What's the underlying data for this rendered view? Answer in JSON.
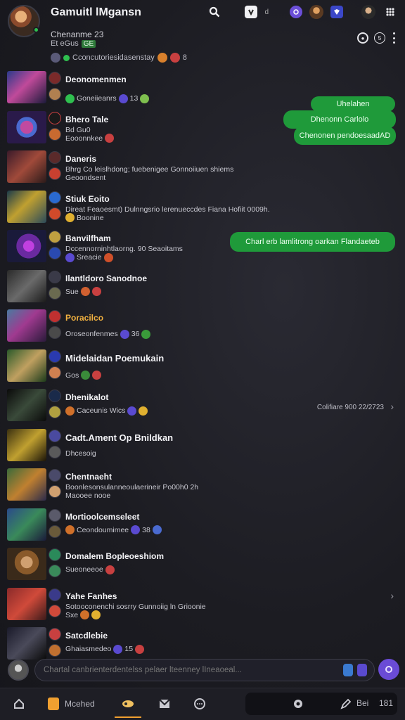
{
  "header": {
    "title": "Gamuitl lMgansn",
    "subtitle": "Chenanme 23",
    "subtitle2": "Et eGus",
    "subtitle2_tag": "GE",
    "status": "Cconcutoriesidasenstay",
    "status_count": "8"
  },
  "conversations": [
    {
      "name": "Deonomenmen",
      "msg": "",
      "meta": "Goneiieanrs",
      "meta_num": "13"
    },
    {
      "name": "Bhero Tale",
      "msg": "Bd Gu0",
      "meta": "Eooonnkee",
      "meta_num": ""
    },
    {
      "name": "Daneris",
      "msg": "Bhrg Co leislhdong; fuebenigee Gonnoiiuen shiems",
      "meta": "Geoondsent",
      "meta_num": ""
    },
    {
      "name": "Stiuk Eoito",
      "msg": "Direat Feaoesmt) Dulnngsrio lerenueccdes Fiana Hofiit 0009h.",
      "meta": "Boonine",
      "meta_num": ""
    },
    {
      "name": "Banvilfham",
      "msg": "Dccennorninhtlaorng. 90 Seaoitams",
      "meta": "Sreacie",
      "meta_num": ""
    },
    {
      "name": "Ilantldoro Sanodnoe",
      "msg": "",
      "meta": "Sue",
      "meta_num": ""
    },
    {
      "name": "Poracilco",
      "msg": "",
      "meta": "Oroseonfenmes",
      "meta_num": "36"
    },
    {
      "name": "Midelaidan Poemukain",
      "msg": "",
      "meta": "Gos",
      "meta_num": ""
    },
    {
      "name": "Dhenikalot",
      "msg": "",
      "meta": "Caceunis Wics",
      "meta_num": "",
      "right": "Colifiare 900 22/2723"
    },
    {
      "name": "Cadt.Ament Op Bnildkan",
      "msg": "",
      "meta": "Dhcesoig",
      "meta_num": ""
    },
    {
      "name": "Chentnaeht",
      "msg": "Boonlesonsulanneoulaerineir Po00h0 2h",
      "meta": "Maooee nooe",
      "meta_num": ""
    },
    {
      "name": "Mortioolcemseleet",
      "msg": "",
      "meta": "Ceondoumimee",
      "meta_num": "38"
    },
    {
      "name": "Domalem Bopleoeshiom",
      "msg": "",
      "meta": "Sueoneeoe",
      "meta_num": ""
    },
    {
      "name": "Yahe Fanhes",
      "msg": "Sotooconenchi sosrry Gunnoiig ln Grioonie",
      "meta": "Sxe",
      "meta_num": ""
    },
    {
      "name": "Satcdlebie",
      "msg": "",
      "meta": "Ghaiasmedeo",
      "meta_num": "15"
    }
  ],
  "bubbles": {
    "b1": "Uhelahen",
    "b2": "Dhenonn Carlolo",
    "b3": "Chenonen pendoesaadAD",
    "b4": "Charl erb lamlitrong oarkan Flandaeteb"
  },
  "composer": {
    "placeholder": "Chartal canbrienterdentelss pelaer lteenney lIneaoeal..."
  },
  "nav": {
    "mod_label": "Mcehed",
    "right_label": "Bei",
    "right_num": "181"
  },
  "colors": {
    "bubble": "#1f9a3a",
    "accent": "#6a4bd6",
    "active_tab": "#f0a030"
  }
}
